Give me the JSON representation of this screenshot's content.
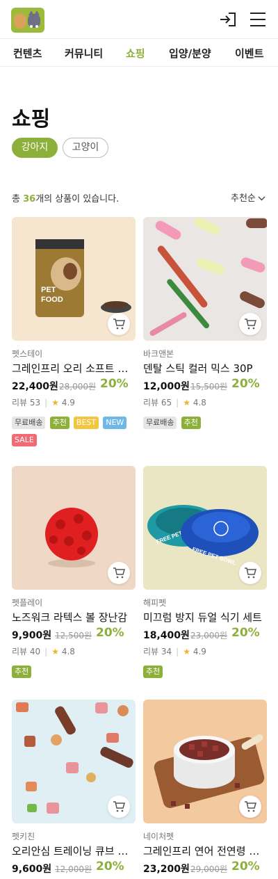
{
  "nav": {
    "items": [
      "컨텐츠",
      "커뮤니티",
      "쇼핑",
      "입양/분양",
      "이벤트"
    ],
    "active_index": 2
  },
  "page": {
    "title": "쇼핑"
  },
  "filters": {
    "chips": [
      "강아지",
      "고양이"
    ],
    "selected": "강아지"
  },
  "summary": {
    "prefix": "총 ",
    "count": "36",
    "suffix": "개의 상품이 있습니다.",
    "sort_label": "추천순"
  },
  "products": [
    {
      "brand": "펫스테이",
      "name": "그레인프리 오리 소프트 사료",
      "price": "22,400원",
      "original_price": "28,000원",
      "discount": "20%",
      "review_label": "리뷰 53",
      "rating": "4.9",
      "tags": [
        "무료배송",
        "추천",
        "BEST",
        "NEW",
        "SALE"
      ],
      "image": "pet-food-bag"
    },
    {
      "brand": "바크앤본",
      "name": "덴탈 스틱 컬러 믹스 30P",
      "price": "12,000원",
      "original_price": "15,500원",
      "discount": "20%",
      "review_label": "리뷰 65",
      "rating": "4.8",
      "tags": [
        "무료배송",
        "추천"
      ],
      "image": "bone-treats"
    },
    {
      "brand": "펫플레이",
      "name": "노즈워크 라텍스 볼 장난감",
      "price": "9,900원",
      "original_price": "12,500원",
      "discount": "20%",
      "review_label": "리뷰 40",
      "rating": "4.8",
      "tags": [
        "추천"
      ],
      "image": "red-ball-toy"
    },
    {
      "brand": "해피펫",
      "name": "미끄럼 방지 듀얼 식기 세트",
      "price": "18,400원",
      "original_price": "23,000원",
      "discount": "20%",
      "review_label": "리뷰 34",
      "rating": "4.9",
      "tags": [
        "추천"
      ],
      "image": "pet-bowls",
      "bowl_text": "FREE PET BOWL"
    },
    {
      "brand": "펫키친",
      "name": "오리안심 트레이닝 큐브 간식",
      "price": "9,600원",
      "original_price": "12,000원",
      "discount": "20%",
      "review_label": "",
      "rating": "",
      "tags": [],
      "image": "training-treats"
    },
    {
      "brand": "네이처펫",
      "name": "그레인프리 연어 전연령 사료",
      "price": "23,200원",
      "original_price": "29,000원",
      "discount": "20%",
      "review_label": "",
      "rating": "",
      "tags": [],
      "image": "kibble-bowl"
    }
  ],
  "colors": {
    "accent": "#8db03a",
    "star": "#f0b429"
  },
  "icons": {
    "login": "login-icon",
    "menu": "hamburger-menu-icon",
    "cart": "cart-icon",
    "sort": "chevron-down-icon",
    "star": "star-icon"
  }
}
